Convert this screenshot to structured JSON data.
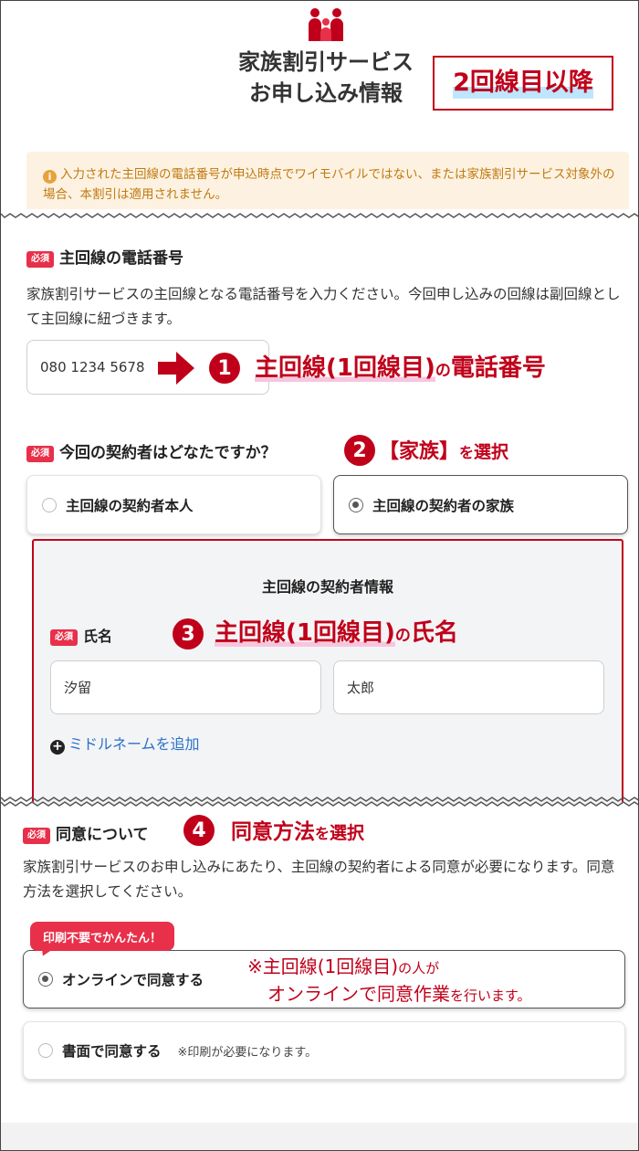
{
  "header": {
    "title_line1": "家族割引サービス",
    "title_line2": "お申し込み情報",
    "badge": "2回線目以降"
  },
  "notice": {
    "icon": "info-icon",
    "text": "入力された主回線の電話番号が申込時点でワイモバイルではない、または家族割引サービス対象外の場合、本割引は適用されません。"
  },
  "required_tag": "必須",
  "phone_section": {
    "label": "主回線の電話番号",
    "description": "家族割引サービスの主回線となる電話番号を入力ください。今回申し込みの回線は副回線として主回線に紐づきます。",
    "input_value": "080 1234 5678"
  },
  "contractor_section": {
    "label": "今回の契約者はどなたですか？",
    "options": [
      {
        "label": "主回線の契約者本人",
        "selected": false
      },
      {
        "label": "主回線の契約者の家族",
        "selected": true
      }
    ]
  },
  "contractor_info": {
    "title": "主回線の契約者情報",
    "name_label": "氏名",
    "last_name": "汐留",
    "first_name": "太郎",
    "add_middle_name": "ミドルネームを追加"
  },
  "consent_section": {
    "label": "同意について",
    "description": "家族割引サービスのお申し込みにあたり、主回線の契約者による同意が必要になります。同意方法を選択してください。",
    "promo": "印刷不要でかんたん！",
    "options": [
      {
        "label": "オンラインで同意する",
        "selected": true,
        "note": ""
      },
      {
        "label": "書面で同意する",
        "selected": false,
        "note": "※印刷が必要になります。"
      }
    ]
  },
  "annotations": {
    "a1": {
      "num": "1",
      "main": "主回線(1回線目)",
      "suffix": "の",
      "tail": "電話番号"
    },
    "a2": {
      "num": "2",
      "main": "【家族】",
      "suffix": "を",
      "tail": "選択"
    },
    "a3": {
      "num": "3",
      "main": "主回線(1回線目)",
      "suffix": "の",
      "tail": "氏名"
    },
    "a4": {
      "num": "4",
      "main": "同意方法",
      "suffix": "を",
      "tail": "選択"
    },
    "a5": {
      "line1_main": "※主回線(1回線目)",
      "line1_suffix": "の人が",
      "line2_main": "オンラインで同意作業",
      "line2_suffix": "を行います。"
    }
  },
  "colors": {
    "accent_red": "#c0001a",
    "required_pink": "#e8304a",
    "notice_bg": "#fdf2e2",
    "notice_text": "#c07a10",
    "link_blue": "#2a72c8"
  }
}
